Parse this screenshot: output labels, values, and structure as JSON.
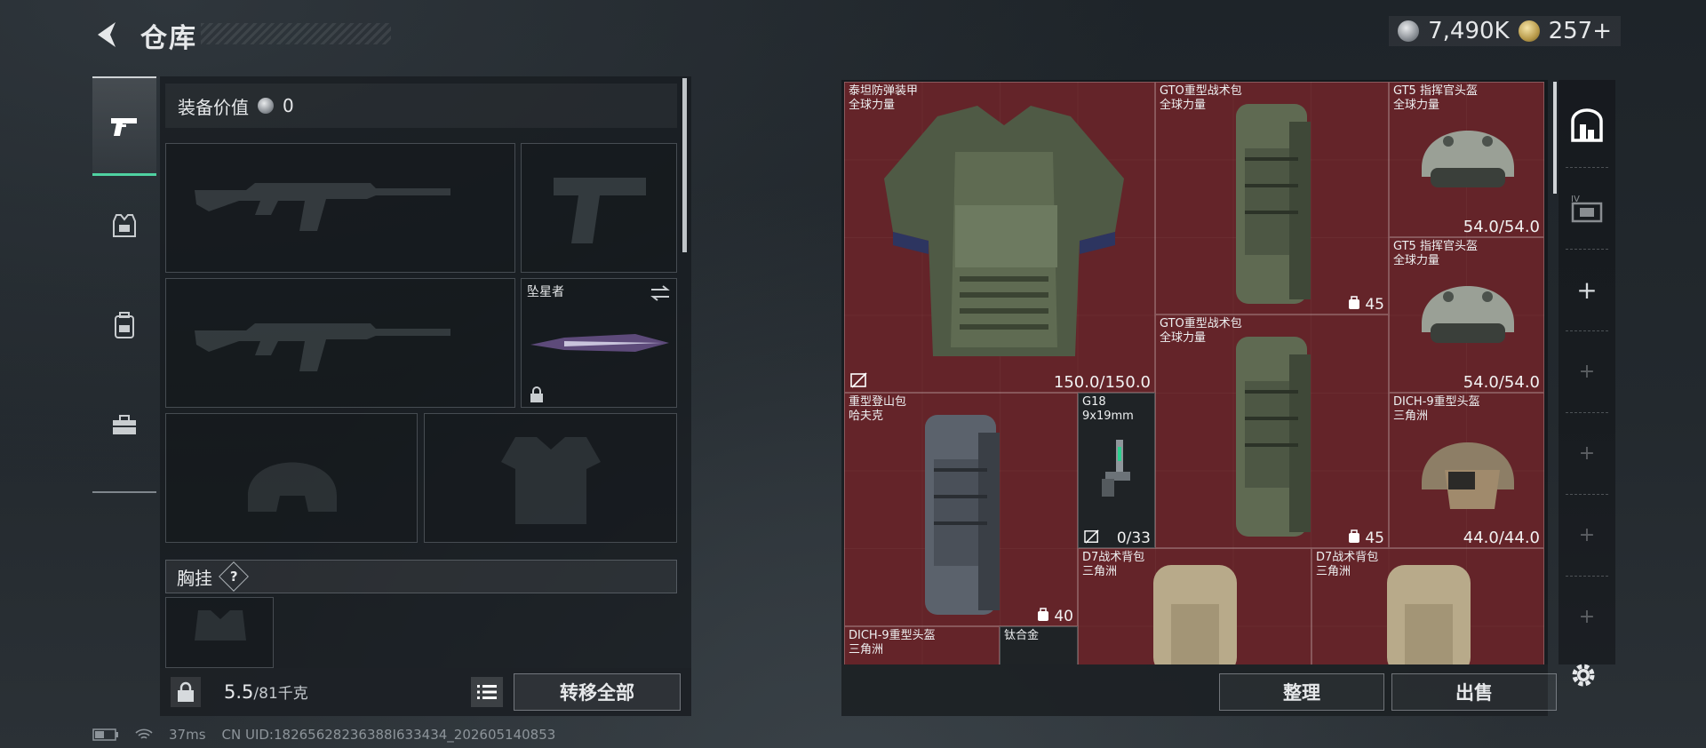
{
  "header": {
    "title": "仓库",
    "currency": [
      {
        "icon": "silver-coin-icon",
        "value": "7,490K"
      },
      {
        "icon": "gold-coin-icon",
        "value": "257+"
      }
    ]
  },
  "tabs": [
    {
      "icon": "pistol-icon",
      "active": true
    },
    {
      "icon": "armor-vest-icon",
      "active": false
    },
    {
      "icon": "backpack-icon",
      "active": false
    },
    {
      "icon": "toolbox-icon",
      "active": false
    }
  ],
  "equipment": {
    "value_label": "装备价值",
    "value": "0",
    "melee_name": "坠星者",
    "chest_label": "胸挂",
    "help": "?",
    "weight_current": "5.5",
    "weight_max": "/81千克",
    "transfer_all": "转移全部"
  },
  "stash": {
    "items": [
      {
        "name": "泰坦防弹装甲",
        "sub": "全球力量",
        "value": "150.0/150.0"
      },
      {
        "name": "GTO重型战术包",
        "sub": "全球力量",
        "value": "45"
      },
      {
        "name": "GT5 指挥官头盔",
        "sub": "全球力量",
        "value": "54.0/54.0"
      },
      {
        "name": "GT5 指挥官头盔",
        "sub": "全球力量",
        "value": "54.0/54.0"
      },
      {
        "name": "GTO重型战术包",
        "sub": "全球力量",
        "value": "45"
      },
      {
        "name": "重型登山包",
        "sub": "哈夫克",
        "value": "40"
      },
      {
        "name": "G18",
        "sub": "9x19mm",
        "value": "0/33"
      },
      {
        "name": "DICH-9重型头盔",
        "sub": "三角洲",
        "value": "44.0/44.0"
      },
      {
        "name": "D7战术背包",
        "sub": "三角洲",
        "value": ""
      },
      {
        "name": "D7战术背包",
        "sub": "三角洲",
        "value": ""
      },
      {
        "name": "DICH-9重型头盔",
        "sub": "三角洲",
        "value": ""
      },
      {
        "name": "钛合金",
        "sub": "",
        "value": ""
      }
    ],
    "sort": "整理",
    "sell": "出售"
  },
  "status": {
    "ping": "37ms",
    "uid": "CN UID:18265628236388I633434_202605140853"
  },
  "colors": {
    "grid_bg": "#5a2428",
    "accent_green": "#4fd1a1"
  }
}
